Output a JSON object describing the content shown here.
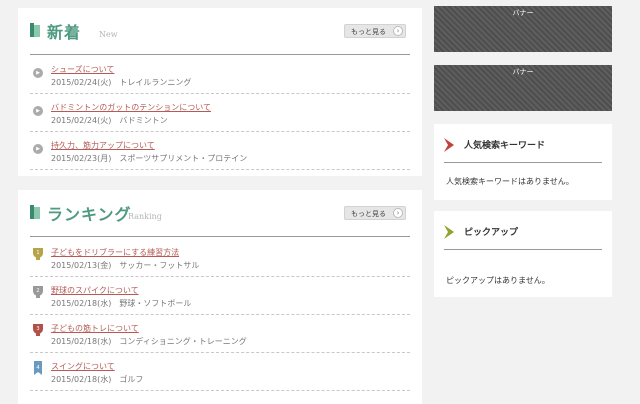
{
  "new_section": {
    "title": "新着",
    "subtitle": "New",
    "more_label": "もっと見る",
    "arrow_glyph": "›",
    "items": [
      {
        "title": "シューズについて",
        "date": "2015/02/24(火)",
        "category": "トレイルランニング"
      },
      {
        "title": "バドミントンのガットのテンションについて",
        "date": "2015/02/24(火)",
        "category": "バドミントン"
      },
      {
        "title": "持久力、筋力アップについて",
        "date": "2015/02/23(月)",
        "category": "スポーツサプリメント・プロテイン"
      }
    ]
  },
  "ranking_section": {
    "title": "ランキング",
    "subtitle": "Ranking",
    "more_label": "もっと見る",
    "arrow_glyph": "›",
    "items": [
      {
        "rank": "1",
        "title": "子どもをドリブラーにする練習方法",
        "date": "2015/02/13(金)",
        "category": "サッカー・フットサル"
      },
      {
        "rank": "2",
        "title": "野球のスパイクについて",
        "date": "2015/02/18(水)",
        "category": "野球・ソフトボール"
      },
      {
        "rank": "3",
        "title": "子どもの筋トレについて",
        "date": "2015/02/18(水)",
        "category": "コンディショニング・トレーニング"
      },
      {
        "rank": "4",
        "title": "スイングについて",
        "date": "2015/02/18(水)",
        "category": "ゴルフ"
      }
    ]
  },
  "banners": [
    "バナー",
    "バナー"
  ],
  "keyword_box": {
    "title": "人気検索キーワード",
    "empty": "人気検索キーワードはありません。"
  },
  "pickup_box": {
    "title": "ピックアップ",
    "empty": "ピックアップはありません。"
  },
  "colors": {
    "accent": "#4f9a80",
    "link": "#b55a55",
    "gold": "#b8a24a",
    "silver": "#9a9a9a",
    "bronze": "#b0524a",
    "blue": "#6a9ac0"
  }
}
